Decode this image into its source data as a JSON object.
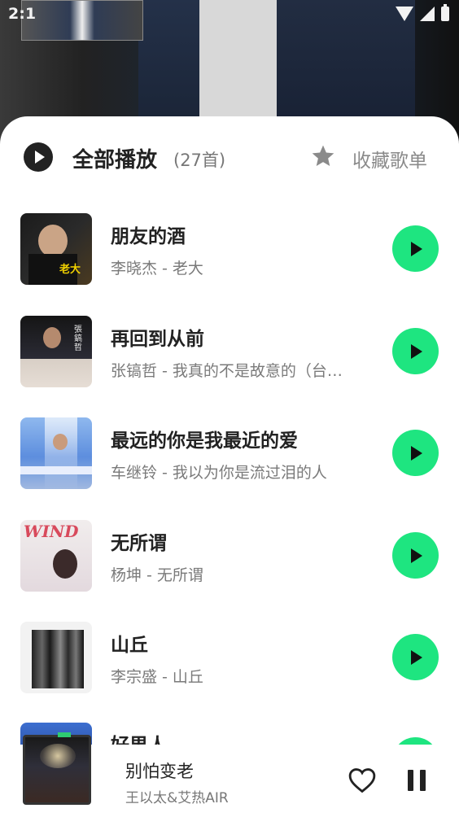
{
  "status_bar": {
    "time": "2:1"
  },
  "header": {
    "play_all_label": "全部播放",
    "count": "(27首)",
    "favorite_label": "收藏歌单"
  },
  "songs": [
    {
      "title": "朋友的酒",
      "subtitle": "李晓杰 - 老大",
      "cover_text": "老大"
    },
    {
      "title": "再回到从前",
      "subtitle": "张镐哲 - 我真的不是故意的（台…",
      "cover_text": "張鎬哲"
    },
    {
      "title": "最远的你是我最近的爱",
      "subtitle": "车继铃 - 我以为你是流过泪的人",
      "cover_text": ""
    },
    {
      "title": "无所谓",
      "subtitle": "杨坤 - 无所谓",
      "cover_text": "WIND"
    },
    {
      "title": "山丘",
      "subtitle": "李宗盛 - 山丘",
      "cover_text": ""
    },
    {
      "title": "好男人",
      "subtitle": "",
      "cover_text": ""
    }
  ],
  "mini_player": {
    "song": "别怕变老",
    "artist": "王以太&艾热AIR"
  },
  "colors": {
    "accent_green": "#1ee580",
    "text_primary": "#222222",
    "text_secondary": "#7a7a7a"
  },
  "icons": {
    "play_all": "play-circle-icon",
    "favorite": "star-icon",
    "row_play": "play-icon",
    "like": "heart-icon",
    "pause": "pause-icon"
  }
}
